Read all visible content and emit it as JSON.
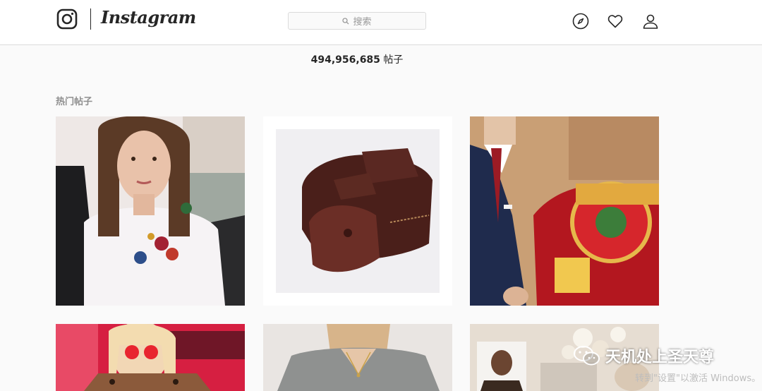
{
  "header": {
    "logo_text": "Instagram",
    "search_placeholder": "搜索",
    "icons": [
      "camera-icon",
      "search-icon",
      "explore-compass-icon",
      "heart-icon",
      "profile-icon"
    ]
  },
  "tag_page": {
    "post_count": "494,956,685",
    "post_count_suffix": "帖子",
    "top_posts_title": "热门帖子"
  },
  "watermark": {
    "brand": "天机处上圣天尊",
    "activate_text": "转到\"设置\"以激活 Windows。"
  },
  "colors": {
    "background": "#fafafa",
    "header_bg": "#ffffff",
    "border": "#dbdbdb",
    "text": "#262626",
    "muted": "#8e8e8e"
  }
}
